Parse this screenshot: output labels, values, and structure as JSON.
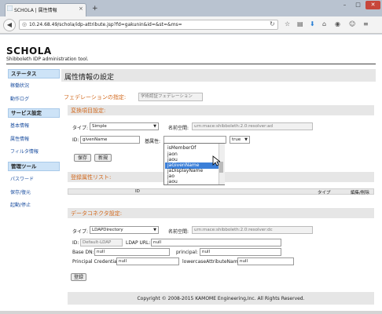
{
  "browser": {
    "tab_title": "SCHOLA | 属性情報",
    "tab_close": "×",
    "new_tab": "+",
    "url": "10.24.68.49/schola/idp-attribute.jsp?fd=gakunin&id=&st=&ms=",
    "win_min": "–",
    "win_max": "□",
    "win_close": "✕"
  },
  "brand": {
    "title": "SCHOLA",
    "subtitle": "Shibboleth IDP administration tool."
  },
  "sidebar": {
    "sections": [
      {
        "title": "ステータス",
        "items": [
          "稼働状況",
          "動作ログ"
        ]
      },
      {
        "title": "サービス設定",
        "items": [
          "基本情報",
          "属性情報",
          "フィルタ情報"
        ]
      },
      {
        "title": "管理ツール",
        "items": [
          "パスワード",
          "保存/復元",
          "起動/停止"
        ]
      }
    ]
  },
  "main": {
    "title": "属性情報の設定",
    "federation_label": "フェデレーションの指定:",
    "federation_value": "学術認証フェデレーション",
    "conversion": {
      "title": "変換項目設定:",
      "type_label": "タイプ:",
      "type_value": "Simple",
      "namespace_label": "名前空間:",
      "namespace_value": "urn:mace:shibboleth:2.0:resolver:ad",
      "id_label": "ID:",
      "id_value": "givenName",
      "dependent_label": "基属性:",
      "dependent_value": "",
      "flag_value": "true",
      "save_button": "保存",
      "new_button": "新規",
      "dropdown_options": [
        "isMemberOf",
        "jaon",
        "jaou",
        "jaGivenName",
        "jaDisplayName",
        "jao",
        "jaou"
      ],
      "dropdown_selected": "jaGivenName"
    },
    "registered": {
      "title": "登録属性リスト:",
      "columns": [
        "ID",
        "タイプ",
        "編集/削除"
      ]
    },
    "connector": {
      "title": "データコネクタ設定:",
      "type_label": "タイプ:",
      "type_value": "LDAPDirectory",
      "namespace_label": "名前空間:",
      "namespace_value": "urn:mace:shibboleth:2.0:resolver:dc",
      "id_label": "ID:",
      "id_value": "Default-LDAP",
      "ldap_url_label": "LDAP URL:",
      "ldap_url_value": "null",
      "base_dn_label": "Base DN:",
      "base_dn_value": "null",
      "principal_label": "principal:",
      "principal_value": "null",
      "credential_label": "Principal Credential:",
      "credential_value": "null",
      "lowercase_label": "lowercaseAttributeNames:",
      "lowercase_value": "null",
      "register_button": "登録"
    },
    "footer": "Copyright © 2008-2015 KAMOME Engineering,Inc. All Rights Reserved."
  }
}
